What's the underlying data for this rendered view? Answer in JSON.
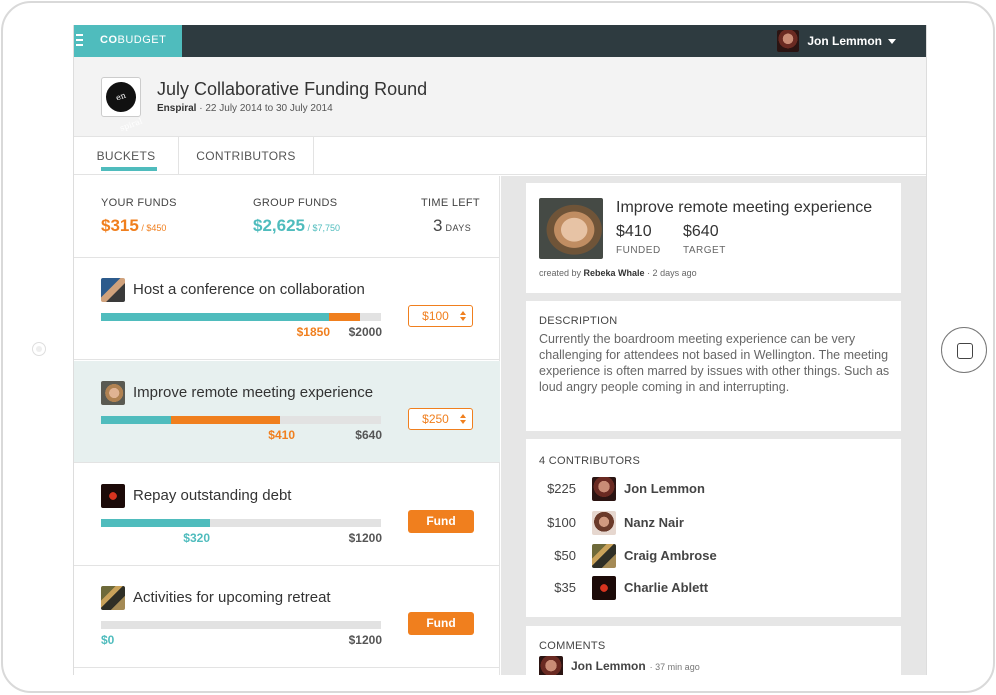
{
  "topbar": {
    "brand_bold": "CO",
    "brand_rest": "BUDGET",
    "user_name": "Jon Lemmon"
  },
  "header": {
    "title": "July Collaborative Funding Round",
    "org": "Enspiral",
    "dates": "22 July 2014 to 30 July 2014",
    "logo_text": "en spiral"
  },
  "tabs": [
    {
      "label": "BUCKETS"
    },
    {
      "label": "CONTRIBUTORS"
    }
  ],
  "funds": {
    "your_label": "YOUR FUNDS",
    "your_value": "$315",
    "your_total": " / $450",
    "group_label": "GROUP FUNDS",
    "group_value": "$2,625",
    "group_total": " / $7,750",
    "time_label": "TIME LEFT",
    "time_value": "3",
    "time_unit": " DAYS"
  },
  "buckets": [
    {
      "name": "Host a conference on collaboration",
      "funded": "$1850",
      "target": "$2000",
      "funded_fraction": 0.925,
      "pledged_fraction": 0.11,
      "action": "$100"
    },
    {
      "name": "Improve remote meeting experience",
      "funded": "$410",
      "target": "$640",
      "funded_fraction": 0.64,
      "pledged_fraction": 0.39,
      "action": "$250"
    },
    {
      "name": "Repay outstanding debt",
      "funded": "$320",
      "target": "$1200",
      "funded_fraction": 0.39,
      "pledged_fraction": 0,
      "action": "Fund"
    },
    {
      "name": "Activities for upcoming retreat",
      "funded": "$0",
      "target": "$1200",
      "funded_fraction": 0,
      "pledged_fraction": 0,
      "action": "Fund"
    }
  ],
  "detail": {
    "title": "Improve remote meeting experience",
    "funded_value": "$410",
    "funded_label": "FUNDED",
    "target_value": "$640",
    "target_label": "TARGET",
    "created_prefix": "created by ",
    "created_by": "Rebeka Whale",
    "created_when": " · 2 days ago",
    "description_heading": "DESCRIPTION",
    "description": "Currently the boardroom meeting experience can be very challenging for attendees not based in Wellington.  The meeting experience is often marred by issues with other things. Such as loud angry people coming in and interrupting.",
    "contributors_heading": "4 CONTRIBUTORS",
    "contributors": [
      {
        "amount": "$225",
        "name": "Jon Lemmon"
      },
      {
        "amount": "$100",
        "name": "Nanz Nair"
      },
      {
        "amount": "$50",
        "name": "Craig Ambrose"
      },
      {
        "amount": "$35",
        "name": "Charlie Ablett"
      }
    ],
    "comments_heading": "COMMENTS",
    "comment_author": "Jon Lemmon",
    "comment_time": "· 37 min ago"
  },
  "colors": {
    "teal": "#4fbcbd",
    "orange": "#f07f1e",
    "topbar": "#2e3b40"
  },
  "icons": [
    "menu-icon",
    "caret-down-icon",
    "stepper-icon"
  ]
}
